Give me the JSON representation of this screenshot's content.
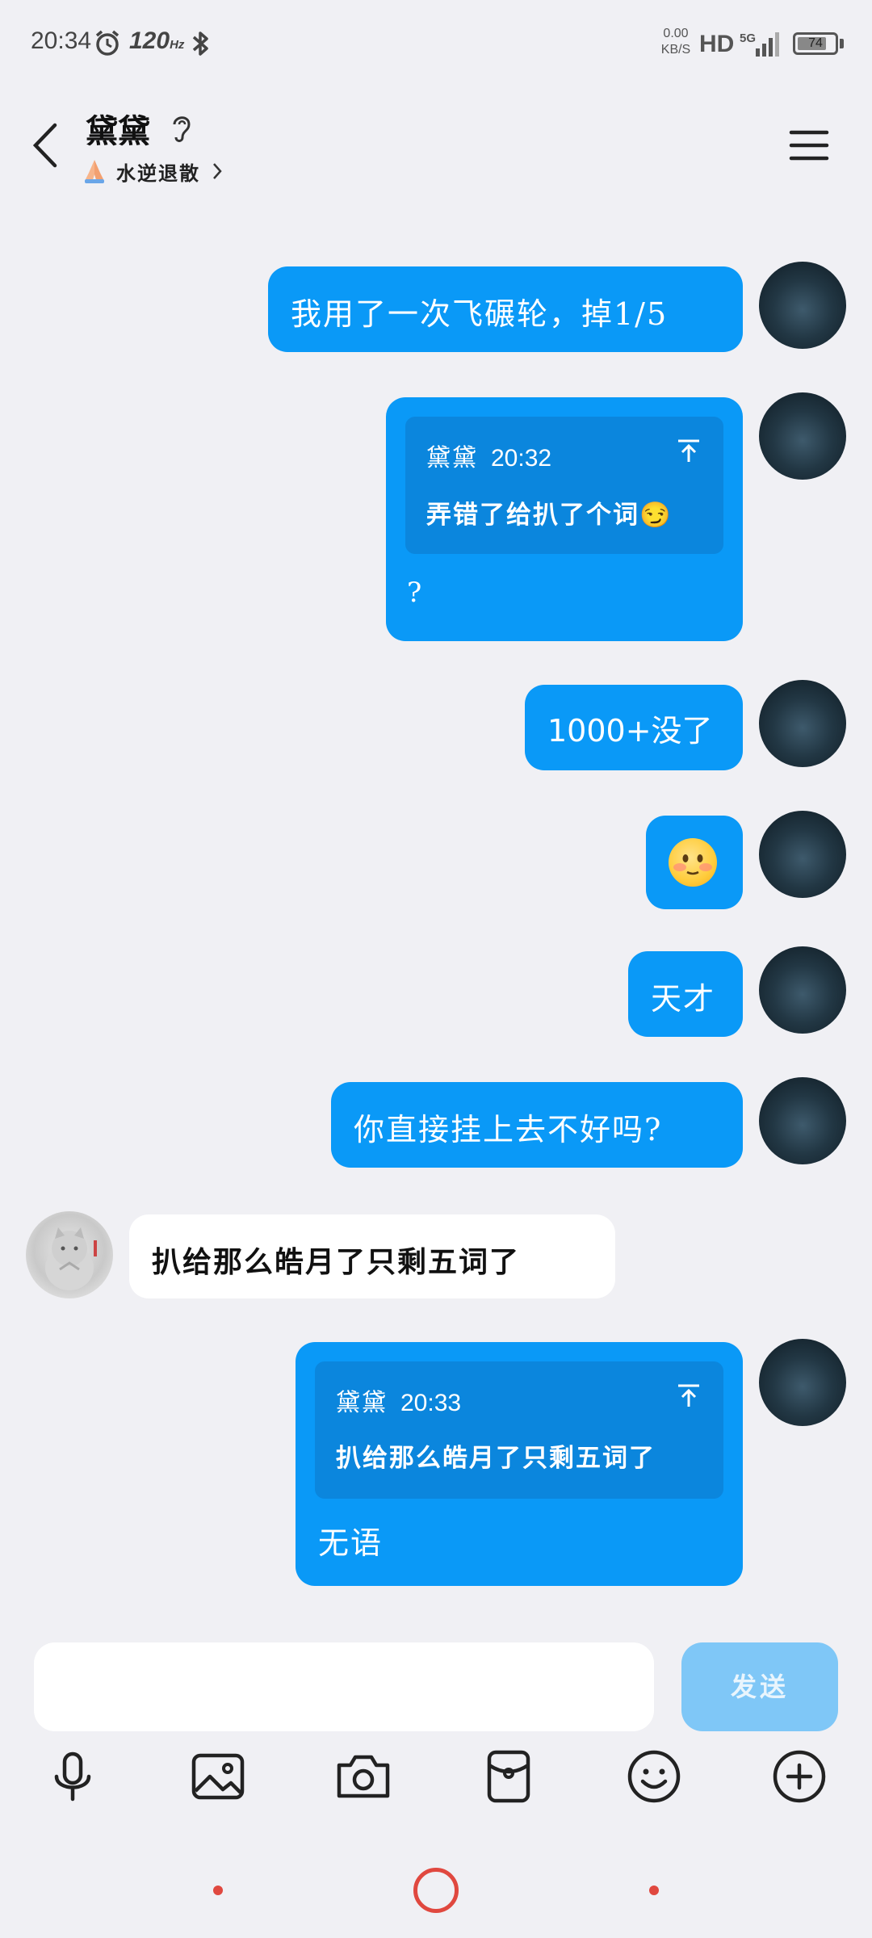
{
  "status_bar": {
    "time": "20:34",
    "refresh_rate": "120",
    "refresh_unit": "Hz",
    "net_speed_value": "0.00",
    "net_speed_unit": "KB/S",
    "hd_label": "HD",
    "network_label": "5G",
    "battery_level": "74",
    "icons": [
      "alarm-icon",
      "bluetooth-icon",
      "signal-icon",
      "battery-icon"
    ]
  },
  "header": {
    "contact_name": "黛黛",
    "status_text": "水逆退散",
    "icons": [
      "back-arrow-icon",
      "ear-icon",
      "pray-hands-icon",
      "chevron-right-icon",
      "menu-icon"
    ]
  },
  "messages": [
    {
      "side": "out",
      "text": "我用了一次飞碾轮，掉1/5"
    },
    {
      "side": "out",
      "quote": {
        "name": "黛黛",
        "time": "20:32",
        "text": "弄错了给扒了个词😏"
      },
      "text": "?"
    },
    {
      "side": "out",
      "text": "1000+没了"
    },
    {
      "side": "out",
      "emoji": "blushing-face"
    },
    {
      "side": "out",
      "text": "天才"
    },
    {
      "side": "out",
      "text": "你直接挂上去不好吗?"
    },
    {
      "side": "in",
      "text": "扒给那么皓月了只剩五词了"
    },
    {
      "side": "out",
      "quote": {
        "name": "黛黛",
        "time": "20:33",
        "text": "扒给那么皓月了只剩五词了"
      },
      "text": "无语"
    }
  ],
  "composer": {
    "input_value": "",
    "send_label": "发送",
    "tools": [
      "microphone-icon",
      "image-icon",
      "camera-icon",
      "red-packet-icon",
      "emoji-icon",
      "plus-icon"
    ]
  },
  "colors": {
    "background": "#f0f0f4",
    "outgoing_bubble": "#0a99f7",
    "quote_block": "#0b86dd",
    "incoming_bubble": "#ffffff",
    "send_button": "#7fc7f7",
    "nav_accent": "#e0483f"
  }
}
